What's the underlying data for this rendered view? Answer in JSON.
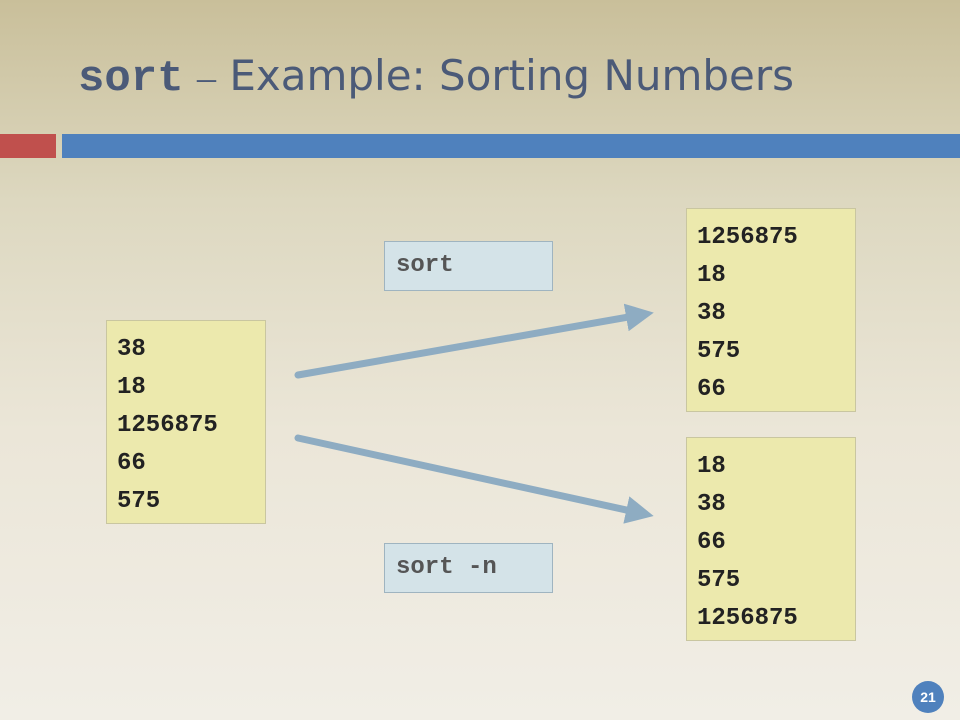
{
  "slide": {
    "title_cmd": "sort",
    "title_dash": "–",
    "title_rest": "Example: Sorting Numbers",
    "page_number": "21"
  },
  "input_lines": [
    "38",
    "18",
    "1256875",
    "66",
    "575"
  ],
  "commands": {
    "sort": "sort",
    "sort_n": "sort -n"
  },
  "output_sort_lines": [
    "1256875",
    "18",
    "38",
    "575",
    "66"
  ],
  "output_sort_n_lines": [
    "18",
    "38",
    "66",
    "575",
    "1256875"
  ],
  "colors": {
    "accent_red": "#c0504d",
    "accent_blue": "#4f81bd",
    "box_fill": "#ece9ad",
    "command_fill": "#d4e3e8",
    "arrow": "#8eacc2"
  }
}
